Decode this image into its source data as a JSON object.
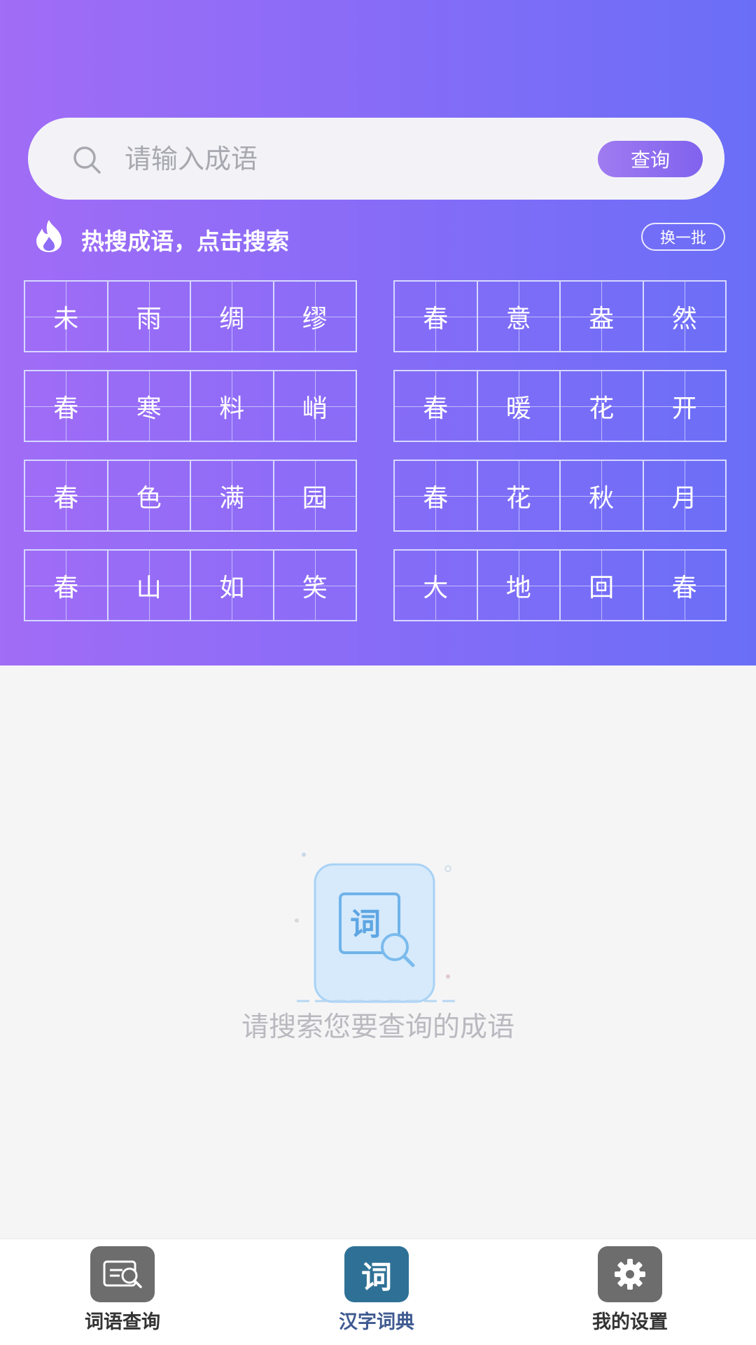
{
  "search": {
    "placeholder": "请输入成语",
    "button_label": "查询"
  },
  "hot": {
    "title": "热搜成语，点击搜索",
    "refresh_label": "换一批",
    "idioms": [
      [
        "未",
        "雨",
        "绸",
        "缪"
      ],
      [
        "春",
        "意",
        "盎",
        "然"
      ],
      [
        "春",
        "寒",
        "料",
        "峭"
      ],
      [
        "春",
        "暖",
        "花",
        "开"
      ],
      [
        "春",
        "色",
        "满",
        "园"
      ],
      [
        "春",
        "花",
        "秋",
        "月"
      ],
      [
        "春",
        "山",
        "如",
        "笑"
      ],
      [
        "大",
        "地",
        "回",
        "春"
      ]
    ]
  },
  "empty_state": {
    "icon_char": "词",
    "text": "请搜索您要查询的成语"
  },
  "bottom_nav": {
    "items": [
      {
        "label": "词语查询",
        "icon": "search-book-icon",
        "active": false
      },
      {
        "label": "汉字词典",
        "icon": "ci-char-icon",
        "icon_char": "词",
        "active": true
      },
      {
        "label": "我的设置",
        "icon": "gear-icon",
        "active": false
      }
    ]
  },
  "colors": {
    "gradient_start": "#a16cf6",
    "gradient_end": "#6a6ef7",
    "active_nav": "#3f5a91",
    "nav_icon_gray": "#6d6d6d",
    "nav_icon_active": "#2f7196"
  }
}
